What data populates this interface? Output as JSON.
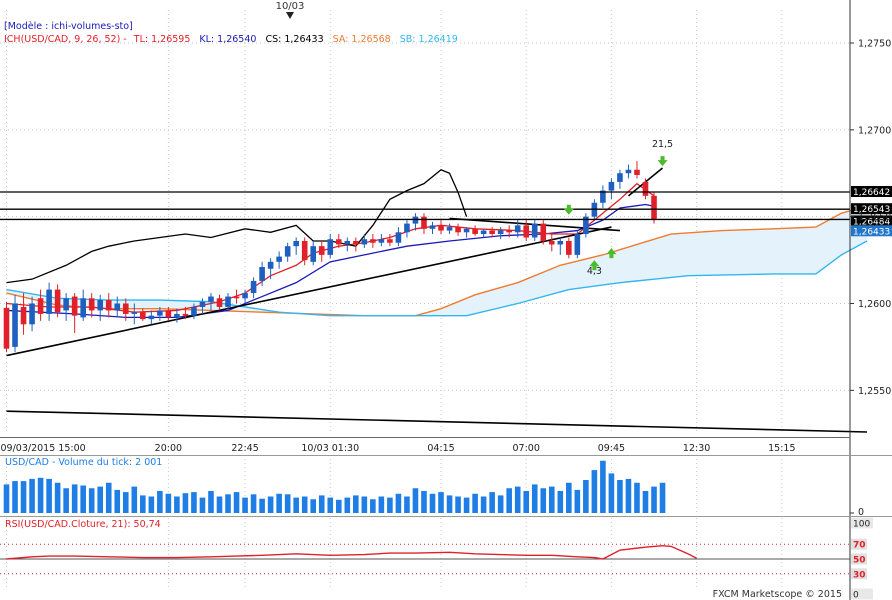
{
  "top_marker": {
    "label": "10/03"
  },
  "legend": {
    "model": "[Modèle : ichi-volumes-sto]",
    "indicator": "ICH(USD/CAD, 9, 26, 52) -",
    "tl": "TL: 1,26595",
    "kl": "KL: 1,26540",
    "cs": "CS: 1,26433",
    "sa": "SA: 1,26568",
    "sb": "SB: 1,26419"
  },
  "colors": {
    "bull": "#1f5fc0",
    "bear": "#e0202a",
    "tenkan": "#e0202a",
    "kijun": "#1a1ab8",
    "chikou": "#000000",
    "senkou_a": "#f07a30",
    "senkou_b": "#33b5ee",
    "cloud": "#e4f3fb",
    "volume": "#1e7ee6",
    "rsi": "#e0202a",
    "grid": "#c8c8c8",
    "price_tag_bg": "#000000",
    "arrow": "#4cbb2a"
  },
  "volume_panel": {
    "label": "USD/CAD - Volume du tick: 2 001"
  },
  "rsi_panel": {
    "label": "RSI(USD/CAD.Cloture, 21): 50,74"
  },
  "footer": {
    "brand": "FXCM Marketscope © 2015"
  },
  "chart_data": {
    "type": "candlestick",
    "instrument": "USD/CAD",
    "price_axis": {
      "ylim": [
        1.2526,
        1.2769
      ],
      "ticks": [
        {
          "v": 1.275,
          "label": "1,2750"
        },
        {
          "v": 1.27,
          "label": "1,2700"
        },
        {
          "v": 1.265,
          "label": "1,2650"
        },
        {
          "v": 1.26,
          "label": "1,2600"
        },
        {
          "v": 1.255,
          "label": "1,2550"
        }
      ],
      "grid": "dashed"
    },
    "time_axis": {
      "bar_count": 82,
      "labels": [
        {
          "bar": 0,
          "label": "09/03/2015 15:00"
        },
        {
          "bar": 19,
          "label": "20:00"
        },
        {
          "bar": 28,
          "label": "22:45"
        },
        {
          "bar": 38,
          "label": "10/03 01:30"
        },
        {
          "bar": 51,
          "label": "04:15"
        },
        {
          "bar": 61,
          "label": "07:00"
        },
        {
          "bar": 71,
          "label": "09:45"
        },
        {
          "bar": 81,
          "label": "12:30"
        },
        {
          "bar": 91,
          "label": "15:15"
        }
      ]
    },
    "candles": [
      {
        "o": 1.25975,
        "h": 1.2601,
        "l": 1.2572,
        "c": 1.2574
      },
      {
        "o": 1.2575,
        "h": 1.2605,
        "l": 1.2572,
        "c": 1.26
      },
      {
        "o": 1.2598,
        "h": 1.2606,
        "l": 1.2582,
        "c": 1.2588
      },
      {
        "o": 1.2588,
        "h": 1.2604,
        "l": 1.2584,
        "c": 1.26
      },
      {
        "o": 1.2603,
        "h": 1.2608,
        "l": 1.259,
        "c": 1.2594
      },
      {
        "o": 1.2594,
        "h": 1.2612,
        "l": 1.259,
        "c": 1.2608
      },
      {
        "o": 1.2608,
        "h": 1.2611,
        "l": 1.2592,
        "c": 1.2595
      },
      {
        "o": 1.2596,
        "h": 1.2606,
        "l": 1.259,
        "c": 1.2603
      },
      {
        "o": 1.2604,
        "h": 1.2606,
        "l": 1.2583,
        "c": 1.2593
      },
      {
        "o": 1.2592,
        "h": 1.2608,
        "l": 1.259,
        "c": 1.2603
      },
      {
        "o": 1.2603,
        "h": 1.2606,
        "l": 1.2592,
        "c": 1.2596
      },
      {
        "o": 1.2596,
        "h": 1.2605,
        "l": 1.259,
        "c": 1.2602
      },
      {
        "o": 1.2602,
        "h": 1.2606,
        "l": 1.2592,
        "c": 1.2596
      },
      {
        "o": 1.2596,
        "h": 1.2604,
        "l": 1.2592,
        "c": 1.26
      },
      {
        "o": 1.26,
        "h": 1.2603,
        "l": 1.259,
        "c": 1.2594
      },
      {
        "o": 1.2594,
        "h": 1.26,
        "l": 1.2588,
        "c": 1.2595
      },
      {
        "o": 1.2595,
        "h": 1.2597,
        "l": 1.259,
        "c": 1.2591
      },
      {
        "o": 1.2591,
        "h": 1.2596,
        "l": 1.2588,
        "c": 1.2593
      },
      {
        "o": 1.2593,
        "h": 1.2598,
        "l": 1.259,
        "c": 1.2596
      },
      {
        "o": 1.2596,
        "h": 1.2598,
        "l": 1.259,
        "c": 1.2592
      },
      {
        "o": 1.2592,
        "h": 1.2597,
        "l": 1.2589,
        "c": 1.2594
      },
      {
        "o": 1.2594,
        "h": 1.2598,
        "l": 1.2591,
        "c": 1.2593
      },
      {
        "o": 1.2593,
        "h": 1.26,
        "l": 1.2591,
        "c": 1.2598
      },
      {
        "o": 1.2598,
        "h": 1.2603,
        "l": 1.2594,
        "c": 1.2601
      },
      {
        "o": 1.2601,
        "h": 1.2606,
        "l": 1.2596,
        "c": 1.2604
      },
      {
        "o": 1.2603,
        "h": 1.2605,
        "l": 1.2596,
        "c": 1.2598
      },
      {
        "o": 1.2598,
        "h": 1.2606,
        "l": 1.2596,
        "c": 1.2604
      },
      {
        "o": 1.2604,
        "h": 1.2608,
        "l": 1.26,
        "c": 1.2603
      },
      {
        "o": 1.2603,
        "h": 1.2608,
        "l": 1.26,
        "c": 1.2606
      },
      {
        "o": 1.2606,
        "h": 1.2615,
        "l": 1.2603,
        "c": 1.2613
      },
      {
        "o": 1.2613,
        "h": 1.2624,
        "l": 1.261,
        "c": 1.2621
      },
      {
        "o": 1.262,
        "h": 1.2626,
        "l": 1.2614,
        "c": 1.2624
      },
      {
        "o": 1.2624,
        "h": 1.263,
        "l": 1.262,
        "c": 1.2627
      },
      {
        "o": 1.2627,
        "h": 1.2635,
        "l": 1.2624,
        "c": 1.2633
      },
      {
        "o": 1.2633,
        "h": 1.2638,
        "l": 1.2628,
        "c": 1.2636
      },
      {
        "o": 1.2636,
        "h": 1.2638,
        "l": 1.2622,
        "c": 1.2625
      },
      {
        "o": 1.2624,
        "h": 1.2636,
        "l": 1.2622,
        "c": 1.2633
      },
      {
        "o": 1.2633,
        "h": 1.2636,
        "l": 1.2624,
        "c": 1.2628
      },
      {
        "o": 1.2628,
        "h": 1.264,
        "l": 1.2626,
        "c": 1.2637
      },
      {
        "o": 1.2637,
        "h": 1.264,
        "l": 1.2632,
        "c": 1.2634
      },
      {
        "o": 1.2634,
        "h": 1.2638,
        "l": 1.263,
        "c": 1.2636
      },
      {
        "o": 1.2636,
        "h": 1.2638,
        "l": 1.263,
        "c": 1.2634
      },
      {
        "o": 1.2634,
        "h": 1.264,
        "l": 1.2632,
        "c": 1.2637
      },
      {
        "o": 1.2637,
        "h": 1.264,
        "l": 1.2632,
        "c": 1.2635
      },
      {
        "o": 1.2635,
        "h": 1.264,
        "l": 1.2633,
        "c": 1.2637
      },
      {
        "o": 1.2637,
        "h": 1.264,
        "l": 1.2633,
        "c": 1.2635
      },
      {
        "o": 1.2635,
        "h": 1.2644,
        "l": 1.2633,
        "c": 1.2641
      },
      {
        "o": 1.2641,
        "h": 1.2648,
        "l": 1.2638,
        "c": 1.2646
      },
      {
        "o": 1.2646,
        "h": 1.2652,
        "l": 1.2642,
        "c": 1.265
      },
      {
        "o": 1.265,
        "h": 1.2652,
        "l": 1.264,
        "c": 1.2643
      },
      {
        "o": 1.2643,
        "h": 1.2647,
        "l": 1.264,
        "c": 1.2645
      },
      {
        "o": 1.2645,
        "h": 1.2648,
        "l": 1.264,
        "c": 1.2642
      },
      {
        "o": 1.2642,
        "h": 1.2646,
        "l": 1.264,
        "c": 1.2644
      },
      {
        "o": 1.2644,
        "h": 1.2646,
        "l": 1.2639,
        "c": 1.2641
      },
      {
        "o": 1.2641,
        "h": 1.2644,
        "l": 1.2638,
        "c": 1.2643
      },
      {
        "o": 1.2643,
        "h": 1.2645,
        "l": 1.2639,
        "c": 1.264
      },
      {
        "o": 1.264,
        "h": 1.2643,
        "l": 1.2638,
        "c": 1.2642
      },
      {
        "o": 1.2642,
        "h": 1.2644,
        "l": 1.2638,
        "c": 1.264
      },
      {
        "o": 1.264,
        "h": 1.2644,
        "l": 1.2637,
        "c": 1.2642
      },
      {
        "o": 1.2642,
        "h": 1.2645,
        "l": 1.2638,
        "c": 1.2641
      },
      {
        "o": 1.2641,
        "h": 1.2648,
        "l": 1.2638,
        "c": 1.2645
      },
      {
        "o": 1.2645,
        "h": 1.2648,
        "l": 1.2636,
        "c": 1.2638
      },
      {
        "o": 1.2638,
        "h": 1.2648,
        "l": 1.2636,
        "c": 1.2646
      },
      {
        "o": 1.2646,
        "h": 1.2648,
        "l": 1.2634,
        "c": 1.2636
      },
      {
        "o": 1.2636,
        "h": 1.264,
        "l": 1.263,
        "c": 1.2634
      },
      {
        "o": 1.2634,
        "h": 1.2638,
        "l": 1.2628,
        "c": 1.2636
      },
      {
        "o": 1.2636,
        "h": 1.2638,
        "l": 1.2626,
        "c": 1.2628
      },
      {
        "o": 1.2628,
        "h": 1.2642,
        "l": 1.2626,
        "c": 1.264
      },
      {
        "o": 1.264,
        "h": 1.2652,
        "l": 1.2638,
        "c": 1.265
      },
      {
        "o": 1.265,
        "h": 1.266,
        "l": 1.2648,
        "c": 1.2658
      },
      {
        "o": 1.2658,
        "h": 1.2668,
        "l": 1.2655,
        "c": 1.2665
      },
      {
        "o": 1.2665,
        "h": 1.2672,
        "l": 1.266,
        "c": 1.267
      },
      {
        "o": 1.267,
        "h": 1.2677,
        "l": 1.2666,
        "c": 1.2675
      },
      {
        "o": 1.2675,
        "h": 1.268,
        "l": 1.2672,
        "c": 1.2677
      },
      {
        "o": 1.2677,
        "h": 1.2682,
        "l": 1.2672,
        "c": 1.2674
      },
      {
        "o": 1.267,
        "h": 1.2672,
        "l": 1.266,
        "c": 1.2662
      },
      {
        "o": 1.2662,
        "h": 1.2664,
        "l": 1.2646,
        "c": 1.2648
      }
    ],
    "tenkan": [
      [
        0,
        1.26
      ],
      [
        5,
        1.2598
      ],
      [
        10,
        1.2598
      ],
      [
        15,
        1.2595
      ],
      [
        20,
        1.2596
      ],
      [
        25,
        1.2601
      ],
      [
        28,
        1.2606
      ],
      [
        31,
        1.2616
      ],
      [
        34,
        1.2622
      ],
      [
        36,
        1.2629
      ],
      [
        39,
        1.2633
      ],
      [
        42,
        1.2635
      ],
      [
        45,
        1.2638
      ],
      [
        48,
        1.2643
      ],
      [
        51,
        1.2645
      ],
      [
        55,
        1.2643
      ],
      [
        60,
        1.2642
      ],
      [
        64,
        1.264
      ],
      [
        67,
        1.264
      ],
      [
        69,
        1.2648
      ],
      [
        72,
        1.266
      ],
      [
        74,
        1.2669
      ],
      [
        76,
        1.2662
      ]
    ],
    "kijun": [
      [
        0,
        1.2596
      ],
      [
        8,
        1.2594
      ],
      [
        14,
        1.2592
      ],
      [
        20,
        1.2592
      ],
      [
        26,
        1.2596
      ],
      [
        30,
        1.2604
      ],
      [
        34,
        1.2612
      ],
      [
        38,
        1.2624
      ],
      [
        42,
        1.2628
      ],
      [
        47,
        1.2633
      ],
      [
        52,
        1.2636
      ],
      [
        58,
        1.2639
      ],
      [
        63,
        1.264
      ],
      [
        67,
        1.2642
      ],
      [
        70,
        1.2648
      ],
      [
        72,
        1.2655
      ],
      [
        75,
        1.2657
      ],
      [
        76,
        1.2656
      ]
    ],
    "chikou": [
      [
        0,
        1.2612
      ],
      [
        3,
        1.2614
      ],
      [
        7,
        1.2622
      ],
      [
        10,
        1.263
      ],
      [
        12,
        1.2633
      ],
      [
        15,
        1.2636
      ],
      [
        18,
        1.2638
      ],
      [
        21,
        1.264
      ],
      [
        24,
        1.2638
      ],
      [
        28,
        1.2643
      ],
      [
        31,
        1.2641
      ],
      [
        34,
        1.2645
      ],
      [
        36,
        1.2636
      ],
      [
        38,
        1.2636
      ],
      [
        41,
        1.2633
      ],
      [
        43,
        1.2645
      ],
      [
        45,
        1.266
      ],
      [
        47,
        1.2665
      ],
      [
        49,
        1.2669
      ],
      [
        51,
        1.2677
      ],
      [
        52,
        1.2675
      ],
      [
        53,
        1.2664
      ],
      [
        54,
        1.265
      ]
    ],
    "senkou_a": [
      [
        0,
        1.2606
      ],
      [
        6,
        1.2599
      ],
      [
        12,
        1.2597
      ],
      [
        18,
        1.2597
      ],
      [
        24,
        1.2596
      ],
      [
        30,
        1.2595
      ],
      [
        36,
        1.2594
      ],
      [
        42,
        1.2593
      ],
      [
        48,
        1.2593
      ],
      [
        51,
        1.2597
      ],
      [
        55,
        1.2605
      ],
      [
        60,
        1.2612
      ],
      [
        65,
        1.2622
      ],
      [
        70,
        1.2628
      ],
      [
        74,
        1.2634
      ],
      [
        78,
        1.264
      ],
      [
        84,
        1.2642
      ],
      [
        90,
        1.2643
      ],
      [
        95,
        1.2644
      ],
      [
        98,
        1.2652
      ],
      [
        101,
        1.2656
      ]
    ],
    "senkou_b": [
      [
        0,
        1.2608
      ],
      [
        6,
        1.2603
      ],
      [
        12,
        1.2602
      ],
      [
        18,
        1.2602
      ],
      [
        24,
        1.2601
      ],
      [
        28,
        1.2598
      ],
      [
        32,
        1.2595
      ],
      [
        38,
        1.2593
      ],
      [
        46,
        1.2593
      ],
      [
        54,
        1.2593
      ],
      [
        60,
        1.26
      ],
      [
        66,
        1.2608
      ],
      [
        72,
        1.2612
      ],
      [
        76,
        1.2614
      ],
      [
        80,
        1.2616
      ],
      [
        90,
        1.2617
      ],
      [
        95,
        1.2617
      ],
      [
        98,
        1.2628
      ],
      [
        101,
        1.2636
      ]
    ],
    "trendlines": [
      {
        "from": [
          0,
          1.257
        ],
        "to": [
          71,
          1.2644
        ]
      },
      {
        "from": [
          52,
          1.2649
        ],
        "to": [
          72,
          1.2642
        ]
      },
      {
        "from": [
          73,
          1.2662
        ],
        "to": [
          77,
          1.2678
        ]
      },
      {
        "from": [
          0,
          1.2538
        ],
        "to": [
          101,
          1.2526
        ]
      }
    ],
    "horizontal_levels": [
      {
        "value": 1.26642,
        "label": "1,26642"
      },
      {
        "value": 1.26543,
        "label": "1,26543"
      },
      {
        "value": 1.26484,
        "label": "1,26484"
      }
    ],
    "current_price": {
      "value": 1.26433,
      "label": "1,26433"
    },
    "annotations": [
      {
        "bar": 77,
        "y": 1.269,
        "text": "21,5"
      },
      {
        "bar": 69,
        "y": 1.2617,
        "text": "4,3"
      }
    ],
    "arrows": [
      {
        "bar": 77,
        "y": 1.2682,
        "dir": "down"
      },
      {
        "bar": 66,
        "y": 1.2654,
        "dir": "down"
      },
      {
        "bar": 71,
        "y": 1.2629,
        "dir": "up"
      },
      {
        "bar": 69,
        "y": 1.2622,
        "dir": "up"
      }
    ],
    "volume": {
      "ylim": [
        0,
        100
      ],
      "values": [
        52,
        58,
        58,
        62,
        64,
        62,
        55,
        45,
        52,
        50,
        45,
        48,
        55,
        42,
        38,
        48,
        32,
        30,
        40,
        35,
        30,
        36,
        38,
        28,
        40,
        30,
        34,
        38,
        28,
        34,
        26,
        30,
        35,
        34,
        28,
        30,
        25,
        32,
        28,
        24,
        28,
        32,
        30,
        25,
        30,
        28,
        35,
        30,
        45,
        40,
        35,
        38,
        32,
        30,
        28,
        35,
        30,
        38,
        32,
        45,
        48,
        40,
        52,
        45,
        48,
        40,
        55,
        42,
        60,
        78,
        95,
        72,
        60,
        62,
        55,
        40,
        48,
        55
      ]
    },
    "rsi": {
      "ylim": [
        0,
        100
      ],
      "levels": [
        {
          "value": 70,
          "label": "70"
        },
        {
          "value": 50,
          "label": "50"
        },
        {
          "value": 30,
          "label": "30"
        }
      ],
      "ticks": [
        {
          "value": 100,
          "label": "100"
        },
        {
          "value": 0,
          "label": "0"
        }
      ],
      "values": [
        [
          0,
          50
        ],
        [
          3,
          53
        ],
        [
          5,
          54
        ],
        [
          8,
          54
        ],
        [
          12,
          53
        ],
        [
          16,
          52
        ],
        [
          20,
          52
        ],
        [
          24,
          53
        ],
        [
          27,
          54
        ],
        [
          30,
          55
        ],
        [
          34,
          57
        ],
        [
          38,
          55
        ],
        [
          42,
          56
        ],
        [
          45,
          58
        ],
        [
          48,
          58
        ],
        [
          52,
          59
        ],
        [
          55,
          57
        ],
        [
          58,
          56
        ],
        [
          61,
          55
        ],
        [
          64,
          55
        ],
        [
          67,
          53
        ],
        [
          69,
          52
        ],
        [
          70,
          50
        ],
        [
          72,
          62
        ],
        [
          75,
          66
        ],
        [
          77,
          68
        ],
        [
          78,
          67
        ],
        [
          80,
          57
        ],
        [
          81,
          51
        ]
      ]
    }
  }
}
